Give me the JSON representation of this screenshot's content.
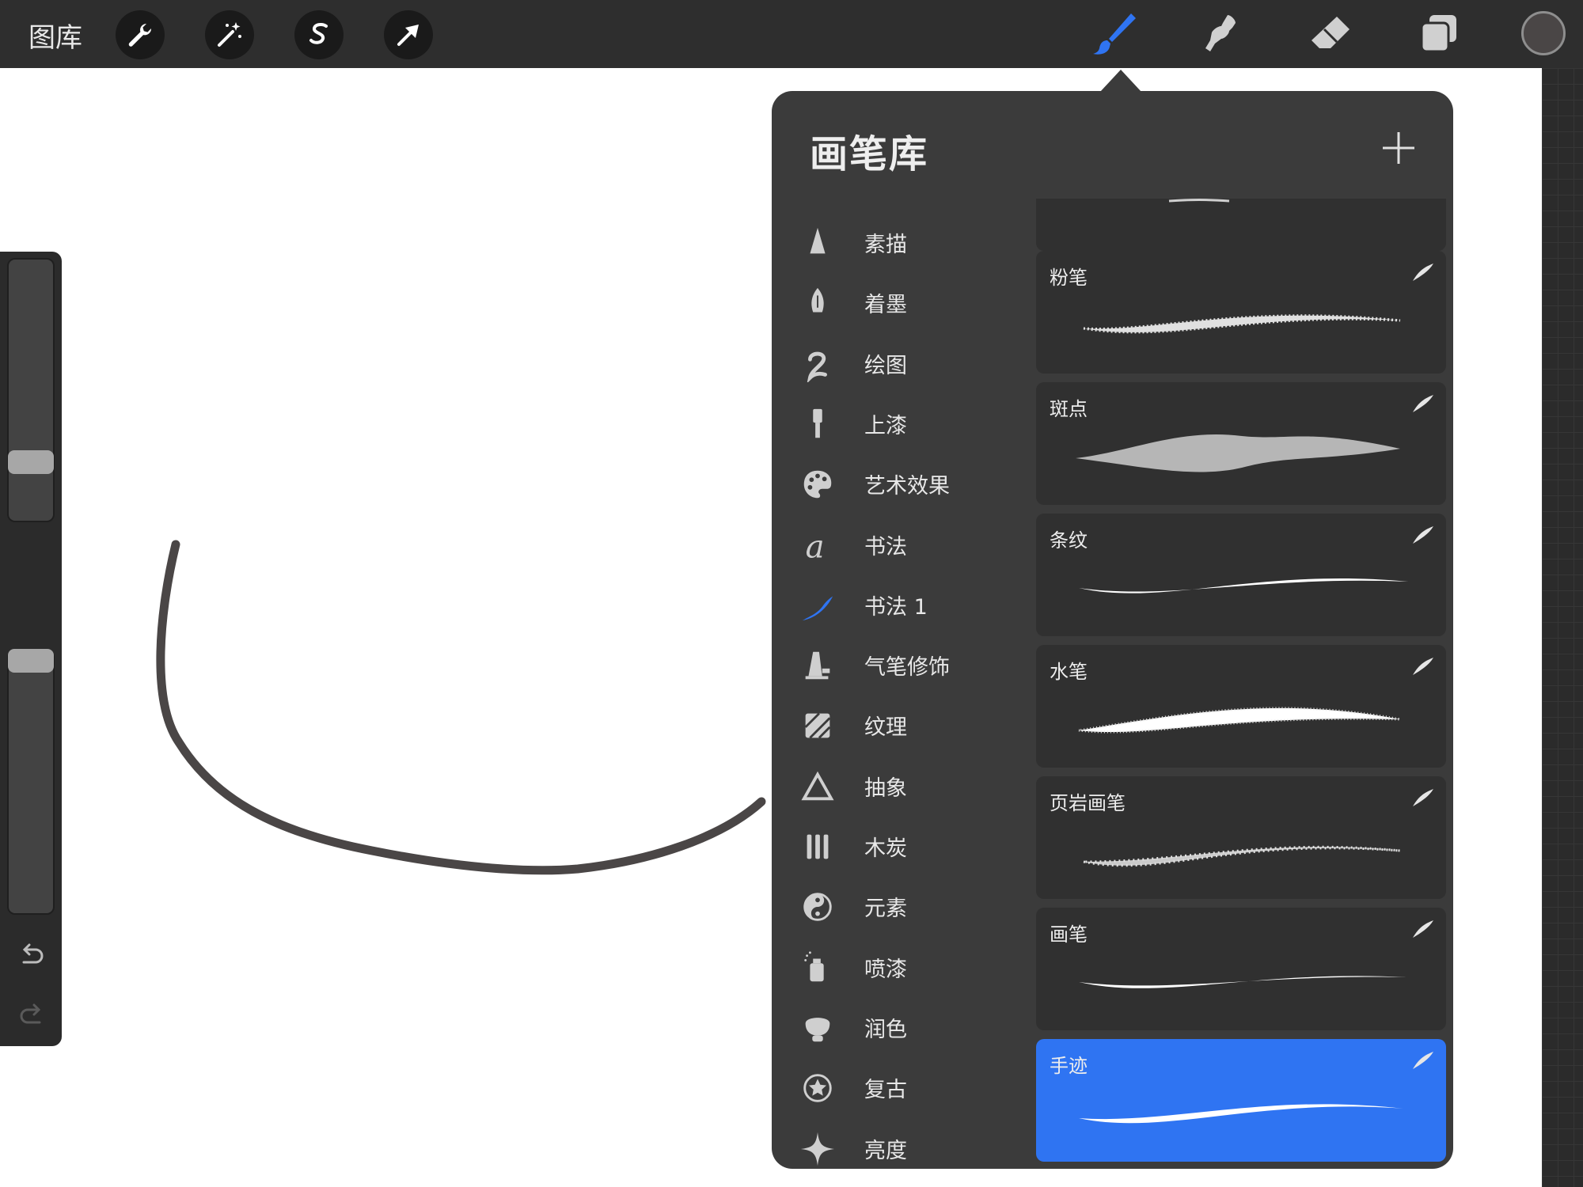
{
  "toolbar": {
    "gallery_label": "图库",
    "left_tools": [
      "wrench-icon",
      "magic-wand-icon",
      "selection-s-icon",
      "transform-arrow-icon"
    ],
    "right_tools": [
      "brush-icon",
      "smudge-icon",
      "eraser-icon",
      "layers-icon"
    ],
    "active_tool": "brush-icon",
    "accent_color": "#2f74f2",
    "current_color": "#4a4646"
  },
  "side_panel": {
    "brush_size_level": 0.2,
    "opacity_level": 1.0
  },
  "library": {
    "title": "画笔库",
    "categories": [
      {
        "label": "素描",
        "icon": "pencil-tip-icon"
      },
      {
        "label": "着墨",
        "icon": "pen-nib-icon"
      },
      {
        "label": "绘图",
        "icon": "squiggle-icon"
      },
      {
        "label": "上漆",
        "icon": "paint-brush-icon"
      },
      {
        "label": "艺术效果",
        "icon": "palette-icon"
      },
      {
        "label": "书法",
        "icon": "script-a-icon"
      },
      {
        "label": "书法 1",
        "icon": "calligraphy-stroke-icon",
        "selected": true
      },
      {
        "label": "气笔修饰",
        "icon": "airbrush-icon"
      },
      {
        "label": "纹理",
        "icon": "texture-icon"
      },
      {
        "label": "抽象",
        "icon": "triangle-icon"
      },
      {
        "label": "木炭",
        "icon": "charcoal-bars-icon"
      },
      {
        "label": "元素",
        "icon": "yin-yang-icon"
      },
      {
        "label": "喷漆",
        "icon": "spray-can-icon"
      },
      {
        "label": "润色",
        "icon": "blush-brush-icon"
      },
      {
        "label": "复古",
        "icon": "star-badge-icon"
      },
      {
        "label": "亮度",
        "icon": "sparkle-icon"
      }
    ],
    "brushes": [
      {
        "name": "粉笔"
      },
      {
        "name": "斑点"
      },
      {
        "name": "条纹"
      },
      {
        "name": "水笔"
      },
      {
        "name": "页岩画笔"
      },
      {
        "name": "画笔"
      },
      {
        "name": "手迹",
        "selected": true
      }
    ]
  }
}
